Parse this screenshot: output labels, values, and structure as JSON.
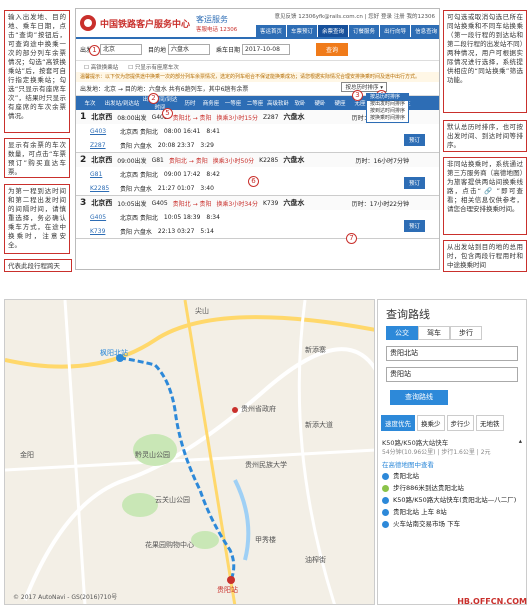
{
  "notes": {
    "left1": "输入出发地、目的地、乘车日期，点击“查询”按钮后，可查询途中换乘一次的部分列车余票情况；勾选“高铁换乘站”后，按套可自行指定换乘站；勾选“只显示有座席车次”，结果时只显示有座席的车次余票情况。",
    "left2": "显示有余票的车次数量，可点击“车票预订”购买直达车票。",
    "left3": "为第一程到达时间和第二程出发时间的间隔时间，请慎重选择，务必确认乘车方式，在途中换乘时，注意安全。",
    "left4": "代表此段行程跨天",
    "right1": "可勾选或取消勾选已所在同站换乘和不同车站换乘（第一段行程的到达站和第二段行程的出发站不同）两种情况，用户可根据实际情况进行选择，系统提供相应的“同站换乘”筛选功能。",
    "right2": "默认总历时排序，也可按出发时间、到达时间等排序。",
    "right3": "非同站换乘时，系统通过第三方服务商（高德地图）为旅客提供两站间换乘线路，点击“ 🔗 ”即可查看；相关信息仅供参考，请您合理安排换乘时间。",
    "right4": "从出发站到目的地的总用时，包含两段行程用时和中途换乘时间"
  },
  "rail": {
    "brand": "中国铁路客户服务中心",
    "brand_sub": "客运服务",
    "hotline": "客服电话 12306",
    "toplinks": "意见反馈 12306yfk@rails.com.cn  |  您好  登录  注册  我的12306",
    "nav": [
      "客运首页",
      "车票预订",
      "余票查询",
      "订餐服务",
      "出行向导",
      "信息查询"
    ],
    "nav_active": 2,
    "from_label": "出发地",
    "from_value": "北京",
    "to_label": "目的地",
    "to_value": "六盘水",
    "date_label": "乘车日期",
    "date_value": "2017-10-08",
    "query_button": "查询",
    "options": [
      "高铁换乘站",
      "只显示有座席车次"
    ],
    "tip": "温馨提示：以下仅为您提供途中换乘一次的部分列车余票情况，选定的列车组合不保证能换乘成功；请您根据实际情况合理安排换乘时间及途中出行方式。",
    "summary": "出发地：北京 → 目的地：六盘水  共有6趟列车，其中6趟有余票",
    "sort_label": "按总历时排序",
    "sort_options": [
      "按总历时排序",
      "按出发时间排序",
      "按到达时间排序",
      "按换乘时间排序"
    ],
    "headers": [
      "车次",
      "出发站/到达站",
      "出发时间/到达时间",
      "历时",
      "商务座",
      "一等座",
      "二等座",
      "高级软卧",
      "软卧",
      "硬卧",
      "硬座",
      "无座",
      "其他",
      "备注"
    ],
    "routes": [
      {
        "no": "1",
        "from": "北京西",
        "from_time": "08:00出发",
        "train1": "G403",
        "hub": "贵阳北 → 贵阳",
        "transfer": "换乘3小时15分",
        "train2": "Z287",
        "to": "六盘水",
        "duration": "历时：15小时17分钟",
        "legs": [
          {
            "train": "G403",
            "stations": "北京西 贵阳北",
            "times": "08:00 16:41",
            "dur": "8:41"
          },
          {
            "train": "Z287",
            "stations": "贵阳 六盘水",
            "times": "20:08 23:37",
            "dur": "3:29"
          }
        ]
      },
      {
        "no": "2",
        "from": "北京西",
        "from_time": "09:00出发",
        "train1": "G81",
        "hub": "贵阳北 → 贵阳",
        "transfer": "换乘3小时50分",
        "train2": "K2285",
        "to": "六盘水",
        "duration": "历时：16小时7分钟",
        "legs": [
          {
            "train": "G81",
            "stations": "北京西 贵阳北",
            "times": "09:00 17:42",
            "dur": "8:42"
          },
          {
            "train": "K2285",
            "stations": "贵阳 六盘水",
            "times": "21:27 01:07",
            "dur": "3:40"
          }
        ]
      },
      {
        "no": "3",
        "from": "北京西",
        "from_time": "10:05出发",
        "train1": "G405",
        "hub": "贵阳北 → 贵阳",
        "transfer": "换乘3小时34分",
        "train2": "K739",
        "to": "六盘水",
        "duration": "历时：17小时22分钟",
        "legs": [
          {
            "train": "G405",
            "stations": "北京西 贵阳北",
            "times": "10:05 18:39",
            "dur": "8:34"
          },
          {
            "train": "K739",
            "stations": "贵阳 六盘水",
            "times": "22:13 03:27",
            "dur": "5:14"
          }
        ]
      }
    ],
    "book_label": "预订"
  },
  "map": {
    "labels": [
      "尖山",
      "枫阳北站",
      "新添寨",
      "贵州省政府",
      "黔灵山公园",
      "云关山公园",
      "贵州民族大学",
      "花果园购物中心",
      "甲秀楼",
      "贵阳站",
      "新添大道",
      "金阳",
      "油榨街"
    ],
    "copyright": "© 2017 AutoNavi - GS(2016)710号"
  },
  "side": {
    "title": "查询路线",
    "tabs": [
      "公交",
      "驾车",
      "步行"
    ],
    "from": "贵阳北站",
    "to": "贵阳站",
    "button": "查询路线",
    "prefs": [
      "速度优先",
      "换乘少",
      "步行少",
      "无地铁"
    ],
    "bus_line": "K50路/K50路大站快车",
    "bus_meta": "54分钟(10.96公里)  |  步行1.6公里  |  2元",
    "link": "在高德地图中查看",
    "steps": [
      {
        "text": "贵阳北站",
        "color": "#2d89d9"
      },
      {
        "text": "步行886米到达贵阳北站",
        "color": "#8bc34a"
      },
      {
        "text": "K50路/K50路大站快车(贵阳北站—八二厂)",
        "color": "#2d89d9"
      },
      {
        "text": "贵阳北站  上车  8站",
        "color": "#2d89d9"
      },
      {
        "text": "火车站南交易市场  下车",
        "color": "#2d89d9"
      }
    ]
  },
  "watermark": "HB.OFFCN.COM"
}
